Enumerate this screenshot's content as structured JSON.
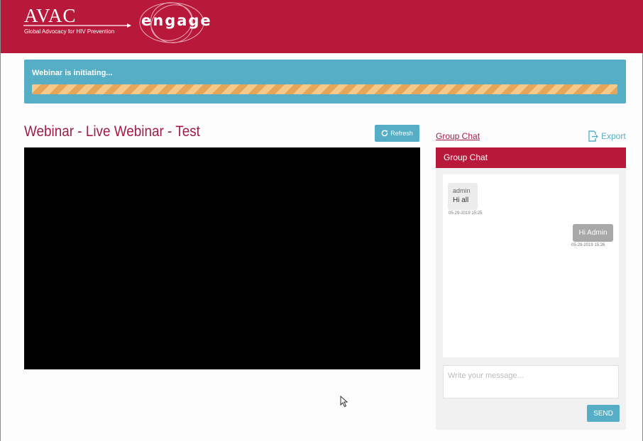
{
  "brand": {
    "name": "AVAC",
    "tagline": "Global Advocacy for HIV Prevention",
    "logo_text": "engage"
  },
  "status": {
    "text": "Webinar is initiating...",
    "progress": 1.0
  },
  "webinar": {
    "title": "Webinar - Live Webinar - Test",
    "refresh_label": "Refresh"
  },
  "chat": {
    "tab_label": "Group Chat",
    "export_label": "Export",
    "header": "Group Chat",
    "messages": [
      {
        "author": "admin",
        "text": "Hi all",
        "time": "05-29-2019 15:25"
      },
      {
        "author": "",
        "text": "Hi Admin",
        "time": "05-29-2019 15:26"
      }
    ],
    "placeholder": "Write your message...",
    "send_label": "SEND"
  },
  "colors": {
    "brand": "#b8193a",
    "accent": "#55aec5",
    "title": "#a11c45"
  },
  "icons": [
    "refresh-icon",
    "export-icon",
    "mouse-cursor-icon"
  ]
}
